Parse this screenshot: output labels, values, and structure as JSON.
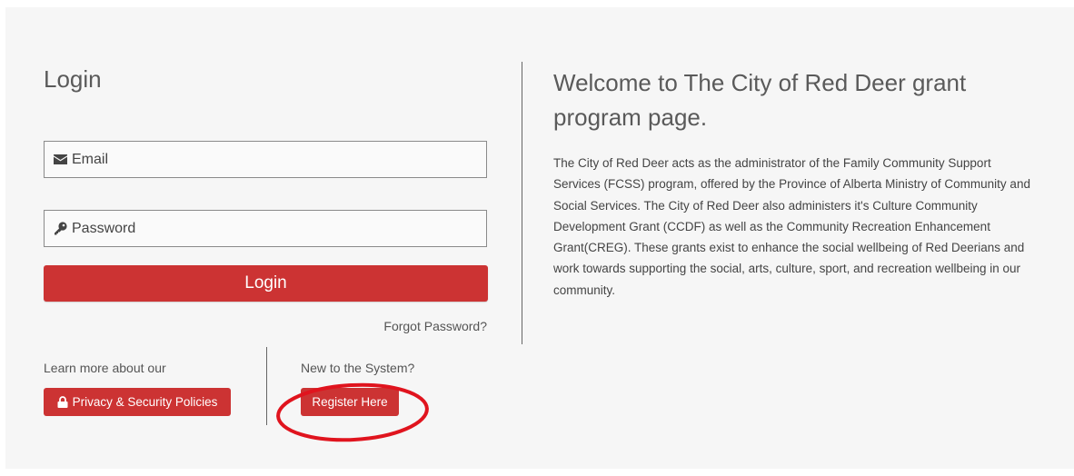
{
  "login": {
    "title": "Login",
    "email_placeholder": "Email",
    "password_placeholder": "Password",
    "login_button": "Login",
    "forgot_password": "Forgot Password?"
  },
  "privacy": {
    "text": "Learn more about our",
    "button": "Privacy & Security Policies",
    "icon": "lock-icon"
  },
  "register": {
    "text": "New to the System?",
    "button": "Register Here"
  },
  "welcome": {
    "title": "Welcome to The City of Red Deer grant program page.",
    "body": "The City of Red Deer acts as the administrator of the Family Community Support Services (FCSS) program, offered by the Province of Alberta Ministry of Community and Social Services. The City of Red Deer also administers it's Culture Community Development Grant (CCDF) as well as the Community Recreation Enhancement Grant(CREG). These grants exist to enhance the social wellbeing of Red Deerians and work towards supporting the social, arts, culture, sport, and recreation wellbeing in our community."
  },
  "colors": {
    "accent": "#cc3333",
    "annotation": "#e0141e"
  }
}
